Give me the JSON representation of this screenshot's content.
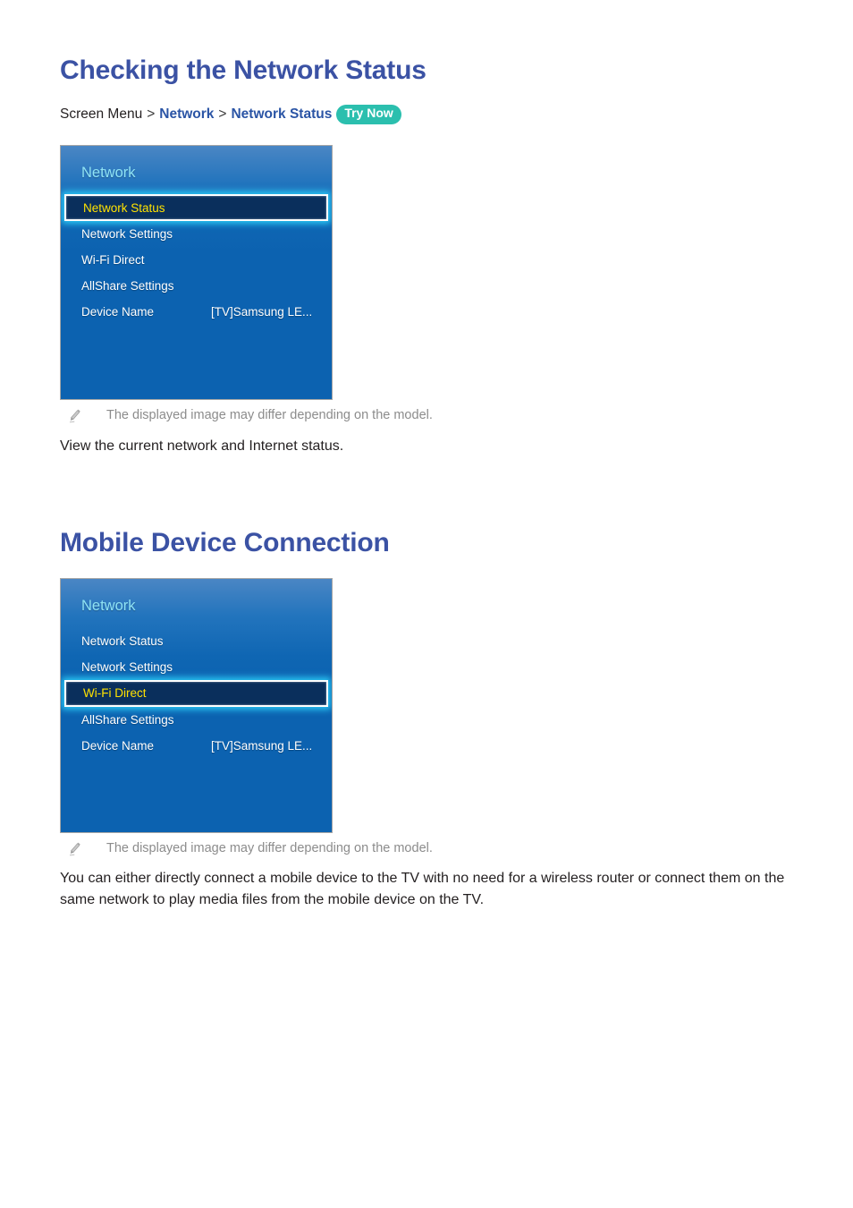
{
  "sections": [
    {
      "id": "checking-network-status",
      "title": "Checking the Network Status",
      "breadcrumb": {
        "root": "Screen Menu",
        "separator": ">",
        "link1": "Network",
        "link2": "Network Status",
        "badge": "Try Now"
      },
      "panel": {
        "heading": "Network",
        "rows": [
          {
            "label": "Network Status",
            "value": "",
            "selected": true
          },
          {
            "label": "Network Settings",
            "value": "",
            "selected": false
          },
          {
            "label": "Wi-Fi Direct",
            "value": "",
            "selected": false
          },
          {
            "label": "AllShare Settings",
            "value": "",
            "selected": false
          },
          {
            "label": "Device Name",
            "value": "[TV]Samsung LE...",
            "selected": false
          }
        ]
      },
      "note": "The displayed image may differ depending on the model.",
      "note_icon": "pencil-icon",
      "body": "View the current network and Internet status."
    },
    {
      "id": "mobile-device-connection",
      "title": "Mobile Device Connection",
      "panel": {
        "heading": "Network",
        "rows": [
          {
            "label": "Network Status",
            "value": "",
            "selected": false
          },
          {
            "label": "Network Settings",
            "value": "",
            "selected": false
          },
          {
            "label": "Wi-Fi Direct",
            "value": "",
            "selected": true
          },
          {
            "label": "AllShare Settings",
            "value": "",
            "selected": false
          },
          {
            "label": "Device Name",
            "value": "[TV]Samsung LE...",
            "selected": false
          }
        ]
      },
      "note": "The displayed image may differ depending on the model.",
      "note_icon": "pencil-icon",
      "body": "You can either directly connect a mobile device to the TV with no need for a wireless router or connect them on the same network to play media files from the mobile device on the TV."
    }
  ],
  "colors": {
    "heading_blue": "#3b52a4",
    "link_blue": "#2a54a5",
    "badge_teal": "#2bbfae",
    "panel_blue": "#0c62b0",
    "panel_gradient_top": "#4a86c4",
    "selected_row_bg": "#0a2f5c",
    "selected_row_text": "#ffe200",
    "selected_glow": "#2ac8f5",
    "panel_heading_text": "#8fe3f5",
    "note_gray": "#8c8c8c",
    "body_text": "#231f20"
  }
}
